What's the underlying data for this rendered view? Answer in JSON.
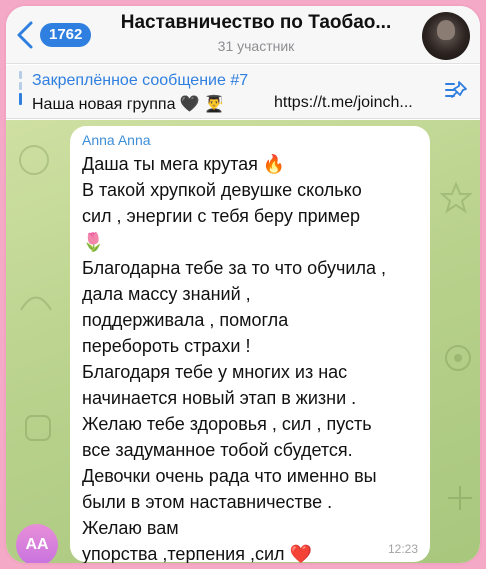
{
  "header": {
    "back_count": "1762",
    "title": "Наставничество по Таобао...",
    "subtitle": "31 участник"
  },
  "pinned": {
    "title": "Закреплённое сообщение #7",
    "text": "Наша новая группа 🖤 👨‍🎓",
    "link": "https://t.me/joinch..."
  },
  "message": {
    "sender": "Anna Anna",
    "lines": [
      "Даша ты мега крутая 🔥",
      "В такой хрупкой девушке сколько",
      "сил , энергии с тебя беру пример",
      "🌷",
      "Благодарна тебе за то что обучила ,",
      "дала массу знаний ,",
      "поддерживала , помогла",
      "перебороть страхи !",
      " Благодаря тебе у многих из нас",
      "начинается новый этап в  жизни .",
      "Желаю тебе здоровья , сил , пусть",
      "все задуманное тобой сбудется.",
      "Девочки очень рада что именно вы",
      "были в этом наставничестве .",
      "Желаю вам",
      "упорства ,терпения ,сил ❤️"
    ],
    "time": "12:23",
    "avatar_initials": "AA"
  },
  "icons": {
    "back": "chevron-left-icon",
    "pin": "pinned-list-icon"
  },
  "colors": {
    "accent": "#2f7fe0",
    "sender": "#3f8ed8",
    "frame": "#f3a3c2",
    "avatar": "#d37fdd"
  }
}
